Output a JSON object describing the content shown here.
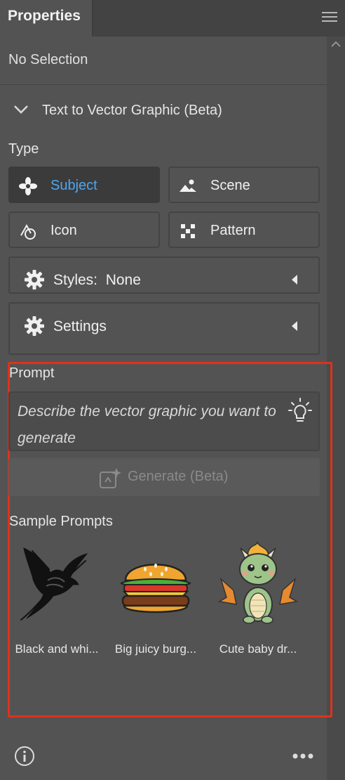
{
  "panel": {
    "tab_title": "Properties",
    "selection_status": "No Selection"
  },
  "section": {
    "title": "Text to Vector Graphic (Beta)",
    "expanded": true
  },
  "type": {
    "label": "Type",
    "options": [
      {
        "label": "Subject",
        "icon": "flower-icon",
        "selected": true
      },
      {
        "label": "Scene",
        "icon": "landscape-icon",
        "selected": false
      },
      {
        "label": "Icon",
        "icon": "shapes-icon",
        "selected": false
      },
      {
        "label": "Pattern",
        "icon": "checker-pattern-icon",
        "selected": false
      }
    ]
  },
  "styles": {
    "label": "Styles:",
    "value": "None"
  },
  "settings": {
    "label": "Settings"
  },
  "prompt": {
    "label": "Prompt",
    "placeholder": "Describe the vector graphic you want to generate"
  },
  "generate": {
    "label": "Generate (Beta)",
    "enabled": false
  },
  "samples": {
    "label": "Sample Prompts",
    "items": [
      {
        "label": "Black and whi...",
        "image": "black-bird-drawing"
      },
      {
        "label": "Big juicy burg...",
        "image": "burger-illustration"
      },
      {
        "label": "Cute baby dr...",
        "image": "baby-dragon-illustration"
      }
    ]
  },
  "colors": {
    "panel_bg": "#535353",
    "selected_text": "#4ea6f2",
    "highlight_border": "#e0311c"
  }
}
